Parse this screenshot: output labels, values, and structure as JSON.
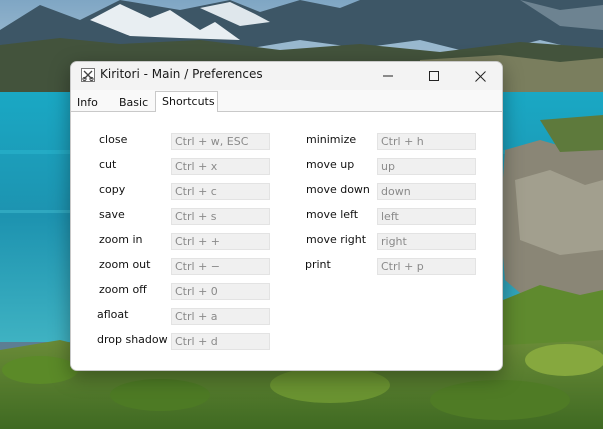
{
  "window": {
    "title": "Kiritori - Main / Preferences"
  },
  "tabs": [
    {
      "label": "Info"
    },
    {
      "label": "Basic"
    },
    {
      "label": "Shortcuts",
      "active": true
    }
  ],
  "shortcuts": {
    "left": [
      {
        "label": "close",
        "value": "Ctrl + w, ESC"
      },
      {
        "label": "cut",
        "value": "Ctrl + x"
      },
      {
        "label": "copy",
        "value": "Ctrl + c"
      },
      {
        "label": "save",
        "value": "Ctrl + s"
      },
      {
        "label": "zoom in",
        "value": "Ctrl + +"
      },
      {
        "label": "zoom out",
        "value": "Ctrl + −"
      },
      {
        "label": "zoom off",
        "value": "Ctrl + 0"
      },
      {
        "label": "afloat",
        "value": "Ctrl + a"
      },
      {
        "label": "drop shadow",
        "value": "Ctrl + d"
      }
    ],
    "right": [
      {
        "label": "minimize",
        "value": "Ctrl + h"
      },
      {
        "label": "move up",
        "value": "up"
      },
      {
        "label": "move down",
        "value": "down"
      },
      {
        "label": "move left",
        "value": "left"
      },
      {
        "label": "move right",
        "value": "right"
      },
      {
        "label": "print",
        "value": "Ctrl + p"
      }
    ]
  },
  "icons": {
    "app": "scissors-app-icon",
    "minimize": "minimize-icon",
    "maximize": "maximize-icon",
    "close": "close-icon"
  },
  "colors": {
    "window_bg": "#f9f9f9",
    "panel_bg": "#ffffff",
    "field_bg": "#f0f0f0",
    "field_text": "#8a8a8a"
  }
}
